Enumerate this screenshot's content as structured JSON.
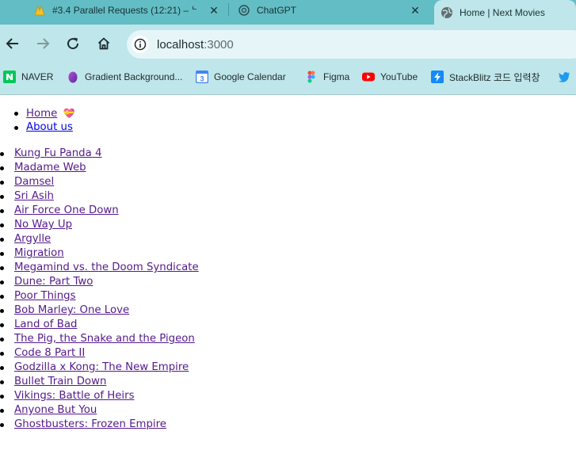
{
  "browser": {
    "tabs": [
      {
        "title": "#3.4 Parallel Requests (12:21) – ᄂ",
        "icon": "nomad-coders-icon"
      },
      {
        "title": "ChatGPT",
        "icon": "chatgpt-icon"
      },
      {
        "title": "Home | Next Movies",
        "icon": "globe-icon"
      }
    ],
    "url_host": "localhost",
    "url_port": ":3000",
    "bookmarks": [
      {
        "label": "NAVER",
        "icon": "naver-icon"
      },
      {
        "label": "Gradient Background...",
        "icon": "gradient-icon"
      },
      {
        "label": "Google Calendar",
        "icon": "calendar-icon"
      },
      {
        "label": "Figma",
        "icon": "figma-icon"
      },
      {
        "label": "YouTube",
        "icon": "youtube-icon"
      },
      {
        "label": "StackBlitz 코드 입력창",
        "icon": "stackblitz-icon"
      }
    ]
  },
  "nav": {
    "home_label": "Home",
    "home_emoji": "💝",
    "about_label": "About us"
  },
  "movies": [
    "Kung Fu Panda 4",
    "Madame Web",
    "Damsel",
    "Sri Asih",
    "Air Force One Down",
    "No Way Up",
    "Argylle",
    "Migration",
    "Megamind vs. the Doom Syndicate",
    "Dune: Part Two",
    "Poor Things",
    "Bob Marley: One Love",
    "Land of Bad",
    "The Pig, the Snake and the Pigeon",
    "Code 8 Part II",
    "Godzilla x Kong: The New Empire",
    "Bullet Train Down",
    "Vikings: Battle of Heirs",
    "Anyone But You",
    "Ghostbusters: Frozen Empire"
  ]
}
